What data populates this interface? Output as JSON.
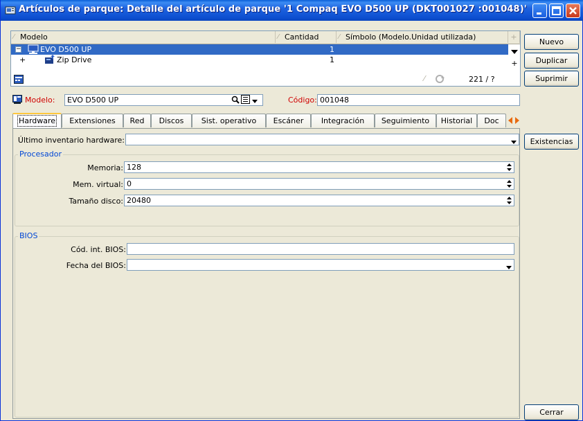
{
  "window": {
    "title": "Artículos de parque: Detalle del artículo de parque '1 Compaq EVO D500 UP (DKT001027 :001048)'",
    "accent": "#0a5fd8"
  },
  "list": {
    "columns": [
      "Modelo",
      "Cantidad",
      "Símbolo (Modelo.Unidad utilizada)"
    ],
    "rows": [
      {
        "expander": "−",
        "icon": "computer-icon",
        "modelo": "EVO D500 UP",
        "cantidad": "1",
        "simbolo": ""
      },
      {
        "expander": "+",
        "icon": "drive-icon",
        "modelo": "Zip Drive",
        "cantidad": "1",
        "simbolo": ""
      }
    ],
    "count": "221 / ?"
  },
  "buttons": {
    "nuevo": "Nuevo",
    "duplicar": "Duplicar",
    "suprimir": "Suprimir",
    "existencias": "Existencias",
    "cerrar": "Cerrar"
  },
  "header_fields": {
    "modelo_label": "Modelo:",
    "modelo_value": "EVO D500 UP",
    "codigo_label": "Código:",
    "codigo_value": "001048",
    "label_color": "#d00000"
  },
  "tabs": [
    "Hardware",
    "Extensiones",
    "Red",
    "Discos",
    "Sist. operativo",
    "Escáner",
    "Integración",
    "Seguimiento",
    "Historial",
    "Doc"
  ],
  "hardware": {
    "ultimo_label": "Último inventario hardware:",
    "ultimo_value": "",
    "procesador": {
      "legend": "Procesador",
      "memoria_label": "Memoria:",
      "memoria_value": "128",
      "memvirtual_label": "Mem. virtual:",
      "memvirtual_value": "0",
      "disco_label": "Tamaño disco:",
      "disco_value": "20480"
    },
    "bios": {
      "legend": "BIOS",
      "cod_label": "Cód. int. BIOS:",
      "cod_value": "",
      "fecha_label": "Fecha del BIOS:",
      "fecha_value": ""
    }
  }
}
